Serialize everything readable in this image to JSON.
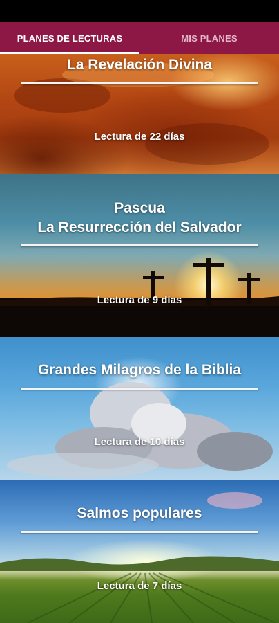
{
  "tabs": [
    {
      "label": "PLANES DE LECTURAS",
      "active": true
    },
    {
      "label": "MIS PLANES",
      "active": false
    }
  ],
  "plans": [
    {
      "title": "La Revelación Divina",
      "duration": "Lectura de 22 días"
    },
    {
      "title": "Pascua\nLa Resurrección del Salvador",
      "duration": "Lectura de 9 días"
    },
    {
      "title": "Grandes Milagros de la Biblia",
      "duration": "Lectura de 10 días"
    },
    {
      "title": "Salmos populares",
      "duration": "Lectura de 7 días"
    }
  ],
  "colors": {
    "tab_bar": "#8e1845",
    "tab_active_text": "#ffffff",
    "tab_inactive_text": "#e3b7c7",
    "indicator": "#ffffff"
  }
}
